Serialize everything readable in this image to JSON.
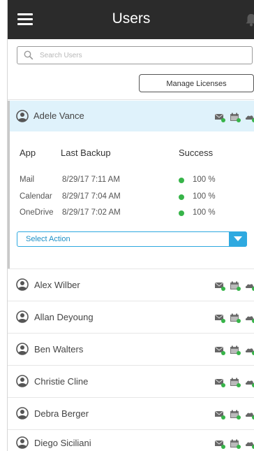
{
  "header": {
    "title": "Users"
  },
  "search": {
    "placeholder": "Search Users"
  },
  "manage_licenses_label": "Manage Licenses",
  "expanded_user": {
    "name": "Adele Vance",
    "columns": {
      "app": "App",
      "last_backup": "Last Backup",
      "success": "Success"
    },
    "backups": [
      {
        "app": "Mail",
        "last_backup": "8/29/17 7:11 AM",
        "success": "100 %"
      },
      {
        "app": "Calendar",
        "last_backup": "8/29/17 7:04 AM",
        "success": "100 %"
      },
      {
        "app": "OneDrive",
        "last_backup": "8/29/17 7:02 AM",
        "success": "100 %"
      }
    ],
    "select_action_label": "Select Action"
  },
  "users": [
    {
      "name": "Alex Wilber"
    },
    {
      "name": "Allan Deyoung"
    },
    {
      "name": "Ben Walters"
    },
    {
      "name": "Christie Cline"
    },
    {
      "name": "Debra Berger"
    },
    {
      "name": "Diego Siciliani"
    }
  ],
  "colors": {
    "header_bg": "#2b2b2b",
    "accent_blue": "#2ea9e0",
    "success_green": "#37b449",
    "expanded_bg": "#dff2fb"
  },
  "icons": {
    "menu": "hamburger-icon",
    "notifications": "bell-icon",
    "search": "search-icon",
    "user": "user-avatar-icon",
    "mail_status": "mail-icon",
    "calendar_status": "calendar-icon",
    "onedrive_status": "onedrive-icon"
  }
}
